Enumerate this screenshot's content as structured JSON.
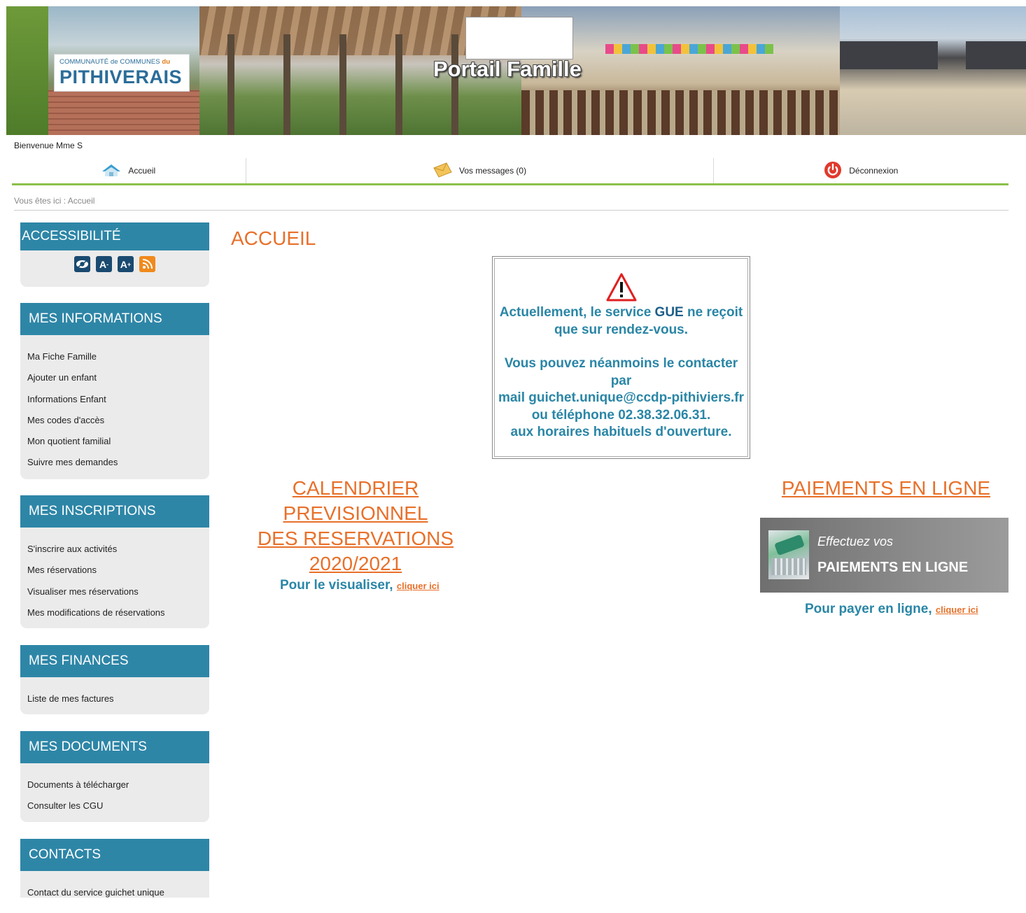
{
  "header": {
    "logo_subtitle": "COMMUNAUTÉ de COMMUNES",
    "logo_subtitle_du": "du",
    "logo_name": "PITHIVERAIS",
    "portal_title": "Portail Famille"
  },
  "welcome": "Bienvenue Mme S",
  "nav": {
    "accueil": "Accueil",
    "messages": "Vos messages (0)",
    "deconnexion": "Déconnexion"
  },
  "breadcrumb": "Vous êtes ici : Accueil",
  "sidebar": {
    "accessibility": {
      "title": "ACCESSIBILITÉ",
      "icons": [
        "contrast-eye-icon",
        "font-decrease-icon",
        "font-increase-icon",
        "rss-icon"
      ],
      "font_decrease": "A",
      "font_increase": "A"
    },
    "informations": {
      "title": "MES INFORMATIONS",
      "items": [
        "Ma Fiche Famille",
        "Ajouter un enfant",
        "Informations Enfant",
        "Mes codes d'accès",
        "Mon quotient familial",
        "Suivre mes demandes"
      ]
    },
    "inscriptions": {
      "title": "MES INSCRIPTIONS",
      "items": [
        "S'inscrire aux activités",
        "Mes réservations",
        "Visualiser mes réservations",
        "Mes modifications de réservations"
      ]
    },
    "finances": {
      "title": "MES FINANCES",
      "items": [
        "Liste de mes factures"
      ]
    },
    "documents": {
      "title": "MES DOCUMENTS",
      "items": [
        "Documents à télécharger",
        "Consulter les CGU"
      ]
    },
    "contacts": {
      "title": "CONTACTS",
      "items": [
        "Contact du service guichet unique"
      ]
    }
  },
  "main": {
    "title": "ACCUEIL",
    "notice": {
      "line1": "Actuellement, le service",
      "line1_bold": "GUE",
      "line1_end": "ne reçoit",
      "line2": "que sur rendez-vous.",
      "line3": "Vous pouvez néanmoins le contacter par",
      "line4": "mail guichet.unique@ccdp-pithiviers.fr",
      "line5": "ou téléphone 02.38.32.06.31.",
      "line6": "aux horaires habituels d'ouverture."
    },
    "calendar": {
      "title_l1": "CALENDRIER PREVISIONNEL",
      "title_l2": "DES RESERVATIONS",
      "title_l3": "2020/2021",
      "cta_text": "Pour le visualiser,",
      "cta_link": "cliquer ici"
    },
    "payments": {
      "title": "PAIEMENTS EN LIGNE",
      "banner_line1": "Effectuez vos",
      "banner_line2": "PAIEMENTS EN LIGNE",
      "cta_text": "Pour payer en ligne,",
      "cta_link": "cliquer ici"
    }
  },
  "colors": {
    "accent_orange": "#e8702a",
    "header_blue": "#2e86a7",
    "nav_green": "#8cc04a",
    "notice_text": "#2a86a6"
  }
}
